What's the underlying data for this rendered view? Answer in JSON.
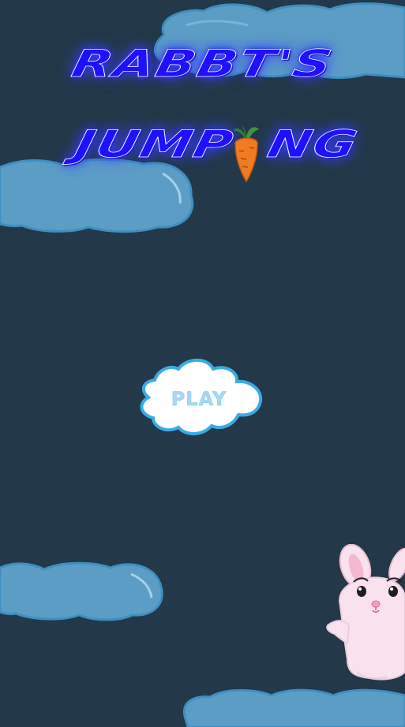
{
  "game": {
    "title_line_1": "RABBT'S",
    "title_line_2_left": "JUMP",
    "title_line_2_right": "NG",
    "play_label": "PLAY"
  },
  "scene": {
    "background_color": "#233848",
    "cloud_color": "#5b9cc5",
    "title_color": "#1f10ff",
    "icons": [
      "carrot-icon",
      "rabbit-character",
      "cloud"
    ]
  }
}
